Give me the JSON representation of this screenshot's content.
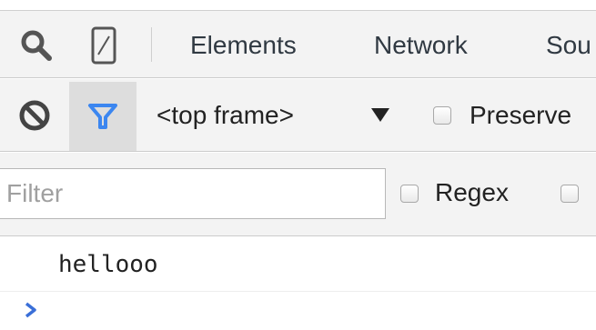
{
  "tabs": [
    {
      "label": "Elements"
    },
    {
      "label": "Network"
    },
    {
      "label": "Sou"
    }
  ],
  "toolbar": {
    "frame_selector": "<top frame>",
    "preserve_log_label": "Preserve"
  },
  "filter": {
    "placeholder": "Filter",
    "regex_label": "Regex"
  },
  "console": {
    "messages": [
      "hellooo"
    ]
  },
  "colors": {
    "filter_icon": "#3b86f0",
    "prompt_chevron": "#3a6fd8",
    "toolbar_bg": "#f3f3f3"
  },
  "icons": [
    "search-icon",
    "device-mode-icon",
    "clear-console-icon",
    "filter-icon",
    "dropdown-arrow-icon",
    "prompt-chevron-icon"
  ]
}
